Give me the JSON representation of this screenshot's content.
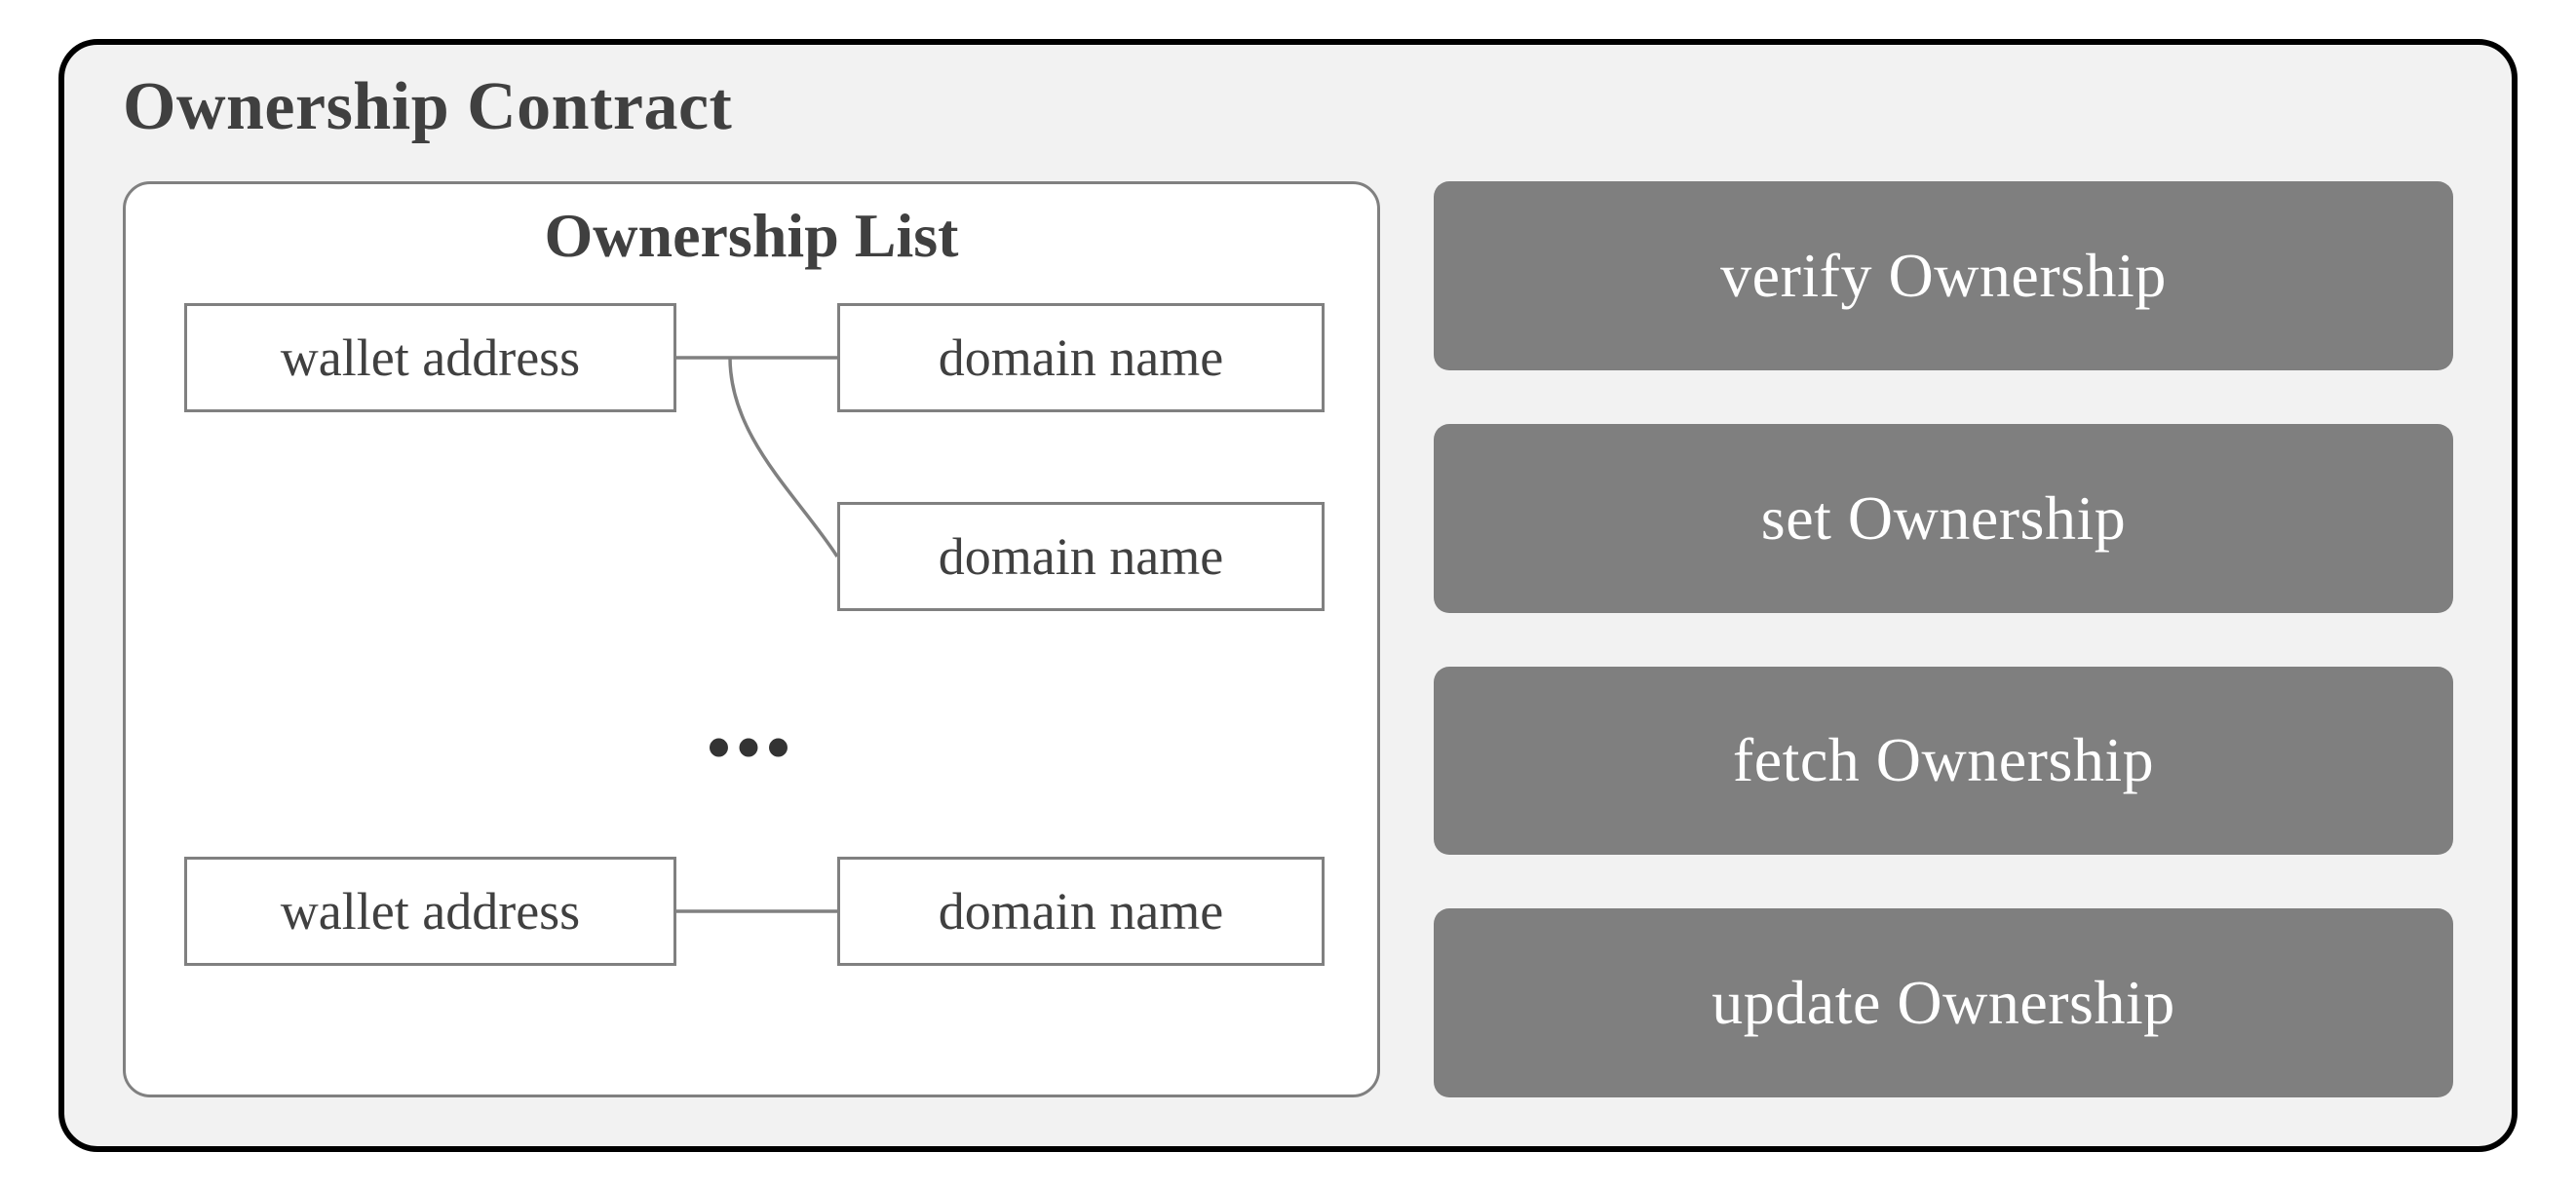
{
  "contract": {
    "title": "Ownership Contract",
    "list": {
      "title": "Ownership List",
      "rows": [
        {
          "wallet": "wallet address",
          "domains": [
            "domain name",
            "domain name"
          ]
        },
        {
          "wallet": "wallet address",
          "domains": [
            "domain name"
          ]
        }
      ],
      "ellipsis": "•••"
    },
    "actions": [
      {
        "label": "verify Ownership"
      },
      {
        "label": "set Ownership"
      },
      {
        "label": "fetch Ownership"
      },
      {
        "label": "update Ownership"
      }
    ]
  },
  "colors": {
    "panel_bg": "#f2f2f2",
    "border_gray": "#808080",
    "action_bg": "#7f7f7f",
    "text_dark": "#404040"
  }
}
